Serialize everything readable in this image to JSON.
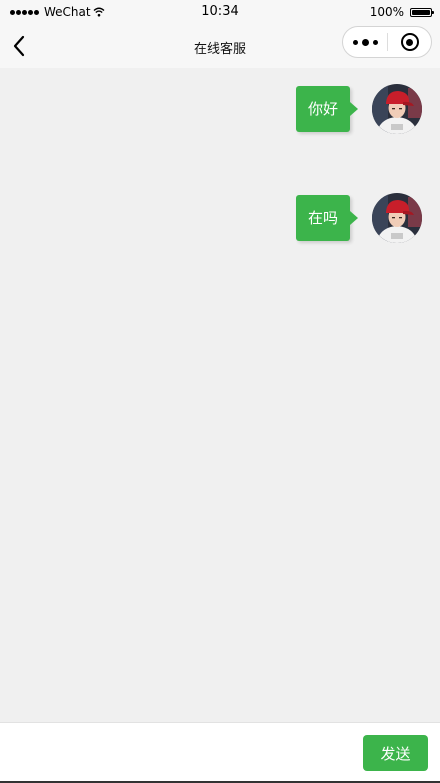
{
  "status_bar": {
    "carrier": "WeChat",
    "time": "10:34",
    "battery_percent": "100%",
    "battery_level": 1.0
  },
  "nav": {
    "title": "在线客服",
    "back_icon": "chevron-left-icon",
    "more_icon": "more-dots-icon",
    "close_icon": "target-circle-icon"
  },
  "messages": [
    {
      "sender": "self",
      "text": "你好",
      "avatar_icon": "user-avatar"
    },
    {
      "sender": "self",
      "text": "在吗",
      "avatar_icon": "user-avatar"
    }
  ],
  "input_bar": {
    "input_value": "",
    "send_label": "发送"
  },
  "colors": {
    "accent": "#3cb44b",
    "chat_background": "#f0f0f0",
    "nav_background": "#f7f7f7"
  }
}
